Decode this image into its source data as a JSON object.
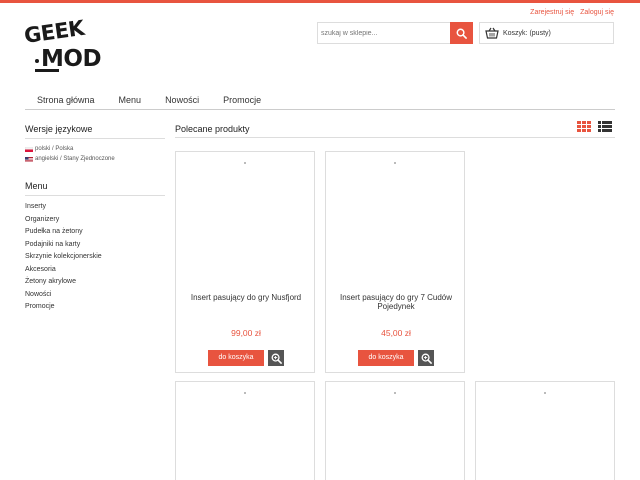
{
  "header": {
    "register_label": "Zarejestruj się",
    "login_label": "Zaloguj się",
    "logo_line1": "GEEK",
    "logo_line2": "MOD",
    "search_placeholder": "szukaj w sklepie...",
    "cart_label": "Koszyk: (pusty)"
  },
  "nav": {
    "items": [
      "Strona główna",
      "Menu",
      "Nowości",
      "Promocje"
    ]
  },
  "sidebar": {
    "languages_heading": "Wersje językowe",
    "languages": [
      "polski / Polska",
      "angielski / Stany Zjednoczone"
    ],
    "menu_heading": "Menu",
    "menu_items": [
      "Inserty",
      "Organizery",
      "Pudełka na żetony",
      "Podajniki na karty",
      "Skrzynie kolekcjonerskie",
      "Akcesoria",
      "Żetony akrylowe",
      "Nowości",
      "Promocje"
    ]
  },
  "main": {
    "heading": "Polecane produkty",
    "add_to_cart_label": "do koszyka",
    "products": [
      {
        "name": "Insert pasujący do gry Nusfjord",
        "price": "99,00 zł"
      },
      {
        "name": "Insert pasujący do gry 7 Cudów Pojedynek",
        "price": "45,00 zł"
      }
    ]
  },
  "colors": {
    "accent": "#e8543f",
    "zoom_button": "#555555"
  },
  "icons": {
    "search": "search-icon",
    "cart": "basket-icon",
    "grid_view": "grid-view-icon",
    "list_view": "list-view-icon",
    "zoom": "magnifier-plus-icon"
  }
}
